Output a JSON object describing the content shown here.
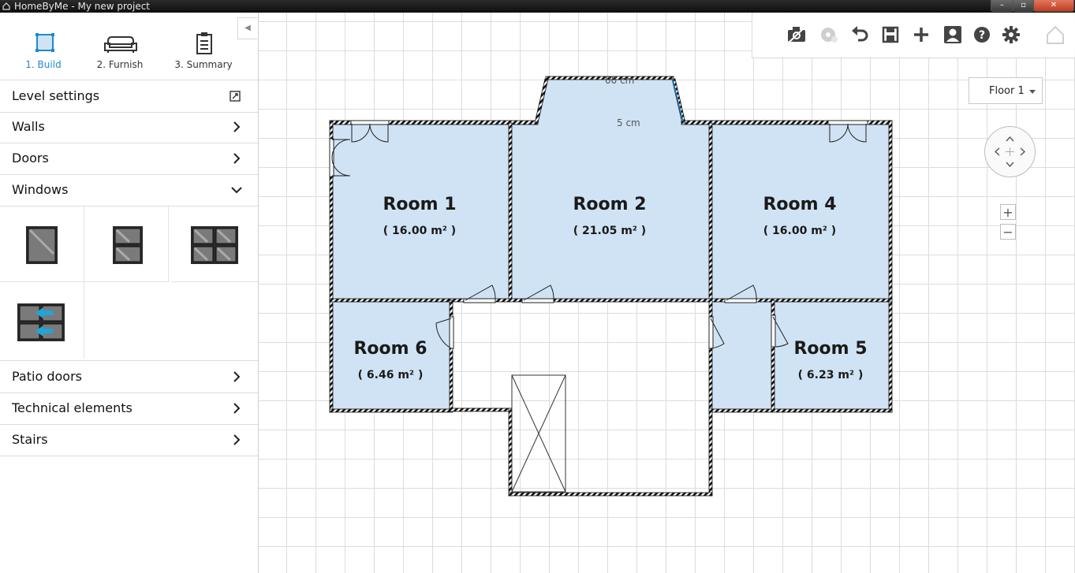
{
  "window": {
    "title": "HomeByMe - My new project",
    "controls": [
      "–",
      "▫",
      "✕"
    ]
  },
  "steps": [
    {
      "label": "1. Build",
      "icon": "build-square-icon",
      "active": true
    },
    {
      "label": "2. Furnish",
      "icon": "sofa-icon",
      "active": false
    },
    {
      "label": "3. Summary",
      "icon": "clipboard-icon",
      "active": false
    }
  ],
  "sidebar": {
    "collapse_glyph": "◀",
    "sections": [
      {
        "label": "Level settings",
        "icon": "level-settings-icon"
      },
      {
        "label": "Walls",
        "icon": "chevron-right-icon"
      },
      {
        "label": "Doors",
        "icon": "chevron-right-icon"
      },
      {
        "label": "Windows",
        "icon": "chevron-down-icon"
      },
      {
        "label": "Patio doors",
        "icon": "chevron-right-icon"
      },
      {
        "label": "Technical elements",
        "icon": "chevron-right-icon"
      },
      {
        "label": "Stairs",
        "icon": "chevron-right-icon"
      }
    ],
    "windows": [
      "single-window-icon",
      "double-hung-window-icon",
      "double-casement-window-icon",
      "sliding-window-icon"
    ]
  },
  "toolbar": {
    "tools": [
      "camera-icon",
      "disc-icon",
      "undo-icon",
      "save-icon",
      "add-icon",
      "account-icon",
      "help-icon",
      "settings-gear-icon",
      "home-view-icon"
    ]
  },
  "floor_select": {
    "value": "Floor 1"
  },
  "zoom": {
    "in": "+",
    "out": "−"
  },
  "plan": {
    "rooms": [
      {
        "name": "Room 1",
        "area": "( 16.00 m² )"
      },
      {
        "name": "Room 2",
        "area": "( 21.05 m² )"
      },
      {
        "name": "Room 4",
        "area": "( 16.00 m² )"
      },
      {
        "name": "Room 6",
        "area": "( 6.46 m² )"
      },
      {
        "name": "Room 5",
        "area": "( 6.23 m² )"
      }
    ],
    "dimensions": [
      "00 cm",
      "5 cm"
    ]
  },
  "colors": {
    "accent": "#1f8ad0",
    "room_fill": "#cfe3f4",
    "wall": "#1a1a1a"
  }
}
